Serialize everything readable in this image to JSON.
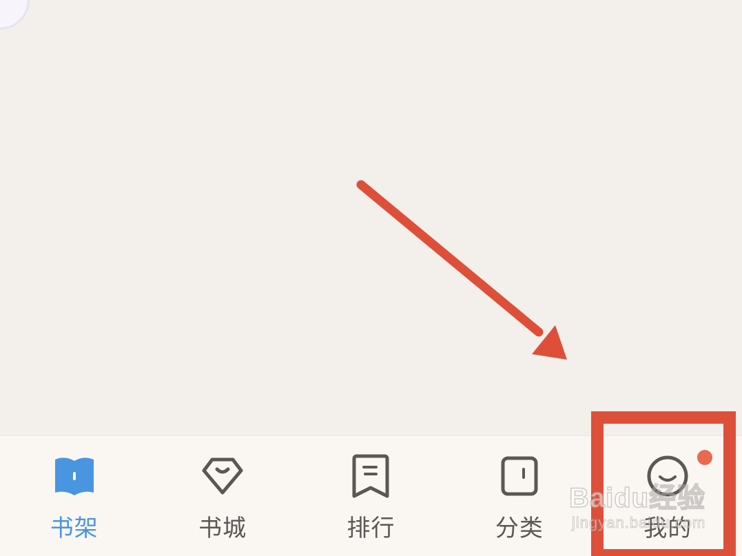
{
  "tabbar": {
    "tabs": [
      {
        "label": "书架",
        "icon": "bookshelf-icon",
        "active": true
      },
      {
        "label": "书城",
        "icon": "bookstore-icon",
        "active": false
      },
      {
        "label": "排行",
        "icon": "ranking-icon",
        "active": false
      },
      {
        "label": "分类",
        "icon": "category-icon",
        "active": false
      },
      {
        "label": "我的",
        "icon": "profile-smile-icon",
        "active": false,
        "badge": true
      }
    ]
  },
  "watermark": {
    "main": "Baidu经验",
    "sub": "jingyan.baidu.com"
  },
  "colors": {
    "background": "#f3efea",
    "tabbar_background": "#faf7f3",
    "active": "#4a95e0",
    "inactive": "#5a5755",
    "badge": "#e96a4f",
    "annotation": "#de4f3a"
  }
}
